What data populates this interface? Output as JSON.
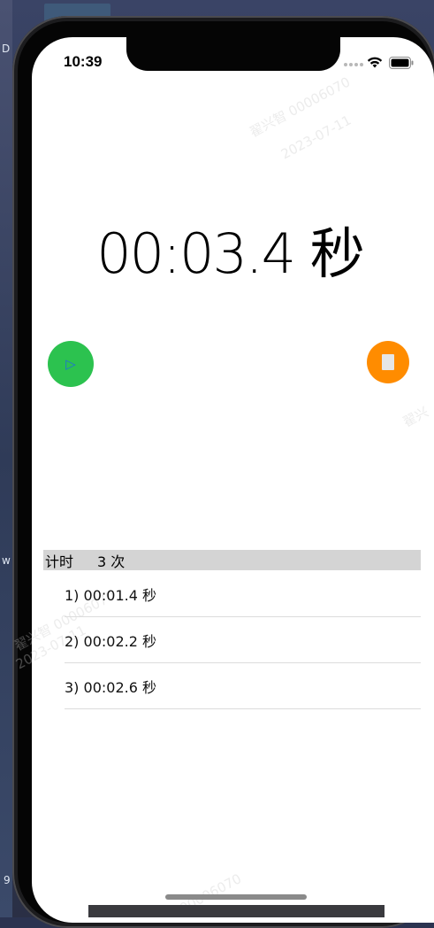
{
  "desktop": {
    "fragments": [
      "D",
      "w",
      "9"
    ]
  },
  "status_bar": {
    "time": "10:39",
    "icons": [
      "signal-dots-icon",
      "wifi-icon",
      "battery-icon"
    ]
  },
  "watermarks": [
    "翟兴智 00006070",
    "2023-07-11",
    "翟兴",
    "翟兴智 00006070",
    "2023-07-11",
    "00006070"
  ],
  "stopwatch": {
    "display": "00:03.4 秒",
    "play_icon": "▷",
    "stop_icon": "stop-square-icon"
  },
  "laps": {
    "title": "计时",
    "count": "3 次",
    "items": [
      {
        "label": "1) 00:01.4 秒"
      },
      {
        "label": "2) 00:02.2 秒"
      },
      {
        "label": "3) 00:02.6 秒"
      }
    ]
  },
  "colors": {
    "play": "#2cc24f",
    "stop": "#ff8c00",
    "play_icon": "#1e6fd9",
    "header_bg": "#d4d4d4"
  }
}
